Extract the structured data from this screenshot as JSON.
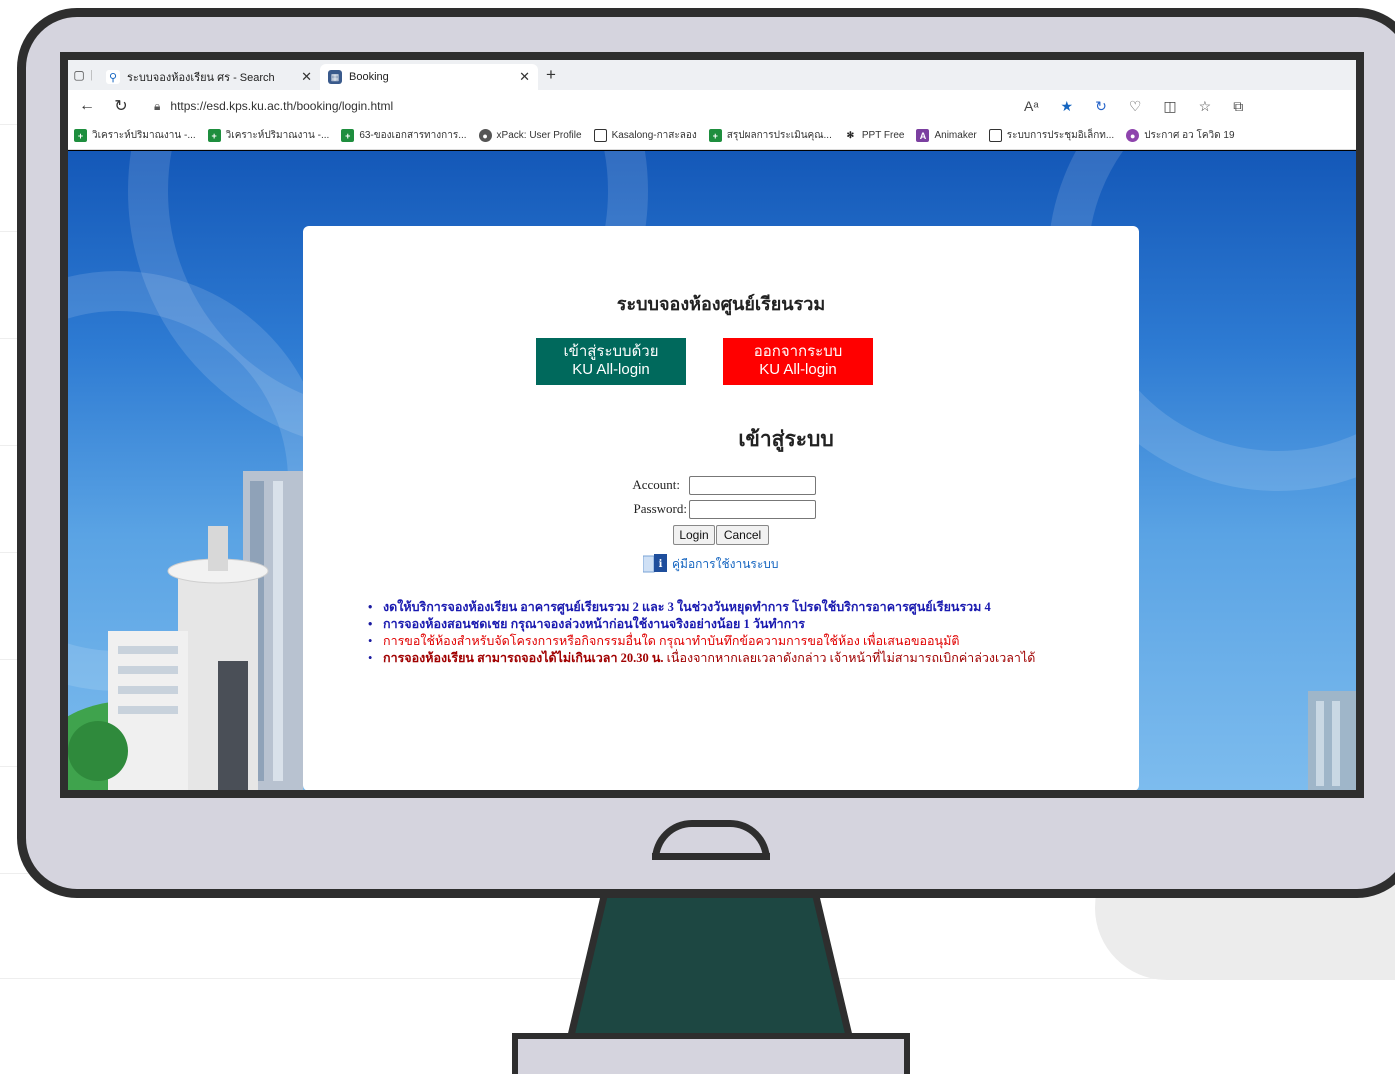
{
  "browser": {
    "tabs": [
      {
        "title": "ระบบจองห้องเรียน ศร - Search",
        "active": false
      },
      {
        "title": "Booking",
        "active": true
      }
    ],
    "url": "https://esd.kps.ku.ac.th/booking/login.html",
    "bookmarks": [
      "วิเคราะห์ปริมาณงาน -...",
      "วิเคราะห์ปริมาณงาน -...",
      "63-ของเอกสารทางการ...",
      "xPack: User Profile",
      "Kasalong-กาสะลอง",
      "สรุปผลการประเมินคุณ...",
      "PPT Free",
      "Animaker",
      "ระบบการประชุมอิเล็กท...",
      "ประกาศ อว โควิด 19"
    ]
  },
  "page": {
    "title": "ระบบจองห้องศูนย์เรียนรวม",
    "login_button": {
      "line1": "เข้าสู่ระบบด้วย",
      "line2": "KU All-login"
    },
    "logout_button": {
      "line1": "ออกจากระบบ",
      "line2": "KU All-login"
    },
    "login_heading": "เข้าสู่ระบบ",
    "account_label": "Account:",
    "password_label": "Password:",
    "account_value": "",
    "password_value": "",
    "login_label": "Login",
    "cancel_label": "Cancel",
    "manual_link": "คู่มือการใช้งานระบบ",
    "notices": [
      "งดให้บริการจองห้องเรียน อาคารศูนย์เรียนรวม 2 และ 3 ในช่วงวันหยุดทำการ โปรดใช้บริการอาคารศูนย์เรียนรวม 4",
      "การจองห้องสอนชดเชย กรุณาจองล่วงหน้าก่อนใช้งานจริงอย่างน้อย 1 วันทำการ",
      "การขอใช้ห้องสำหรับจัดโครงการหรือกิจกรรมอื่นใด กรุณาทำบันทึกข้อความการขอใช้ห้อง เพื่อเสนอขออนุมัติ",
      "การจองห้องเรียน สามารถจองได้ไม่เกินเวลา 20.30 น. เนื่องจากหากเลยเวลาดังกล่าว เจ้าหน้าที่ไม่สามารถเบิกค่าล่วงเวลาได้"
    ],
    "notice4_bold": "การจองห้องเรียน สามารถจองได้ไม่เกินเวลา 20.30 น.",
    "notice4_rest": " เนื่องจากหากเลยเวลาดังกล่าว เจ้าหน้าที่ไม่สามารถเบิกค่าล่วงเวลาได้"
  },
  "colors": {
    "login_btn": "#00695c",
    "logout_btn": "#ff0000",
    "monitor_frame": "#d5d4de",
    "monitor_outline": "#2e2e2e",
    "stand": "#1d4742"
  }
}
